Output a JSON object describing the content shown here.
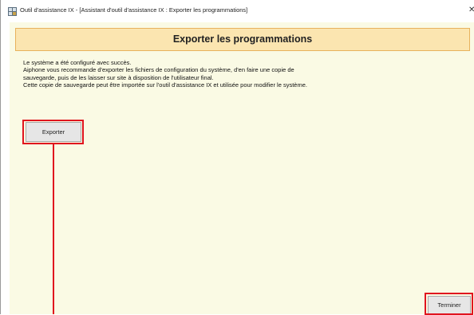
{
  "window": {
    "title": "Outil d'assistance IX - [Assistant d'outil d'assistance IX : Exporter les programmations]",
    "close_glyph": "✕",
    "app_icon": "app-grid-icon"
  },
  "page": {
    "title": "Exporter les programmations",
    "description": [
      "Le système a été configuré avec succès.",
      "Aiphone vous recommande d'exporter les fichiers de configuration du système, d'en faire une copie de",
      "sauvegarde, puis de les laisser sur site à disposition de l'utilisateur final.",
      "Cette copie de sauvegarde peut être importée sur l'outil d'assistance IX et utilisée pour modifier le système."
    ]
  },
  "buttons": {
    "export_label": "Exporter",
    "finish_label": "Terminer"
  },
  "colors": {
    "content_bg": "#fafae4",
    "header_bg": "#fbe5b0",
    "header_border": "#e8b25c",
    "highlight": "#e0141e"
  }
}
